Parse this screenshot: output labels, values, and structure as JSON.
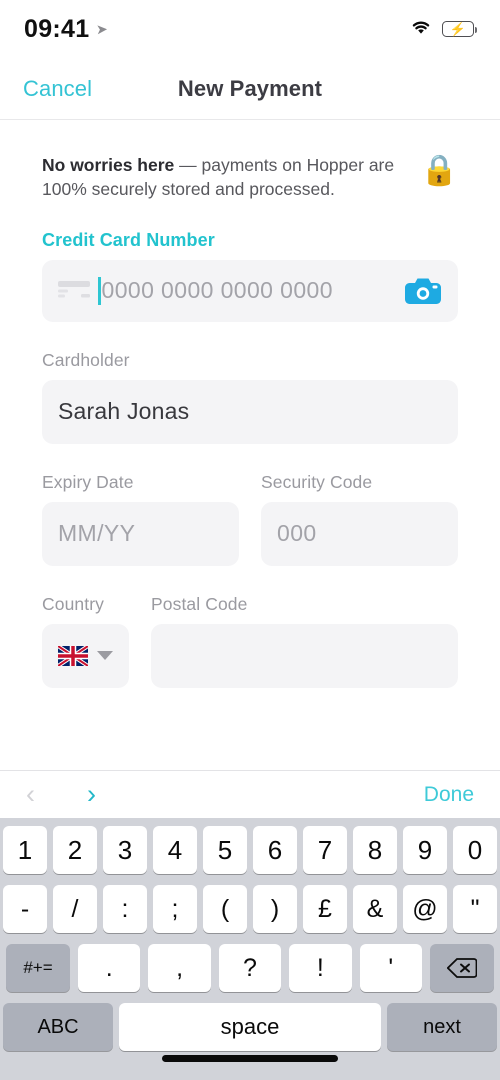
{
  "status_bar": {
    "time": "09:41",
    "location_icon": "location-arrow-icon",
    "wifi_icon": "wifi-icon",
    "battery_icon": "battery-charging-icon"
  },
  "nav": {
    "cancel_label": "Cancel",
    "title": "New Payment"
  },
  "notice": {
    "bold_text": "No worries here",
    "rest_text": " — payments on Hopper are 100% securely stored and processed.",
    "lock_icon": "🔒"
  },
  "form": {
    "card_number": {
      "label": "Credit Card Number",
      "placeholder": "0000 0000 0000 0000",
      "value": "",
      "card_icon": "credit-card-icon",
      "camera_icon": "camera-icon",
      "focused": true
    },
    "cardholder": {
      "label": "Cardholder",
      "value": "Sarah Jonas",
      "placeholder": ""
    },
    "expiry": {
      "label": "Expiry Date",
      "placeholder": "MM/YY",
      "value": ""
    },
    "security_code": {
      "label": "Security Code",
      "placeholder": "000",
      "value": ""
    },
    "country": {
      "label": "Country",
      "selected_flag": "united-kingdom-flag",
      "chevron_icon": "chevron-down-icon"
    },
    "postal_code": {
      "label": "Postal Code",
      "placeholder": "",
      "value": ""
    }
  },
  "keyboard_toolbar": {
    "prev_icon": "chevron-left-icon",
    "next_icon": "chevron-right-icon",
    "done_label": "Done"
  },
  "keyboard": {
    "row1": [
      "1",
      "2",
      "3",
      "4",
      "5",
      "6",
      "7",
      "8",
      "9",
      "0"
    ],
    "row2": [
      "-",
      "/",
      ":",
      ";",
      "(",
      ")",
      "£",
      "&",
      "@",
      "\""
    ],
    "row3_modifier": "#+=",
    "row3": [
      ".",
      ",",
      "?",
      "!",
      "'"
    ],
    "row3_backspace": "backspace-icon",
    "row4": {
      "abc": "ABC",
      "space": "space",
      "next": "next"
    }
  },
  "colors": {
    "accent_teal": "#22c3ce",
    "camera_blue": "#1eaae2",
    "field_bg": "#f4f4f6",
    "keyboard_bg": "#d1d3d9",
    "battery_green": "#33d94a"
  }
}
